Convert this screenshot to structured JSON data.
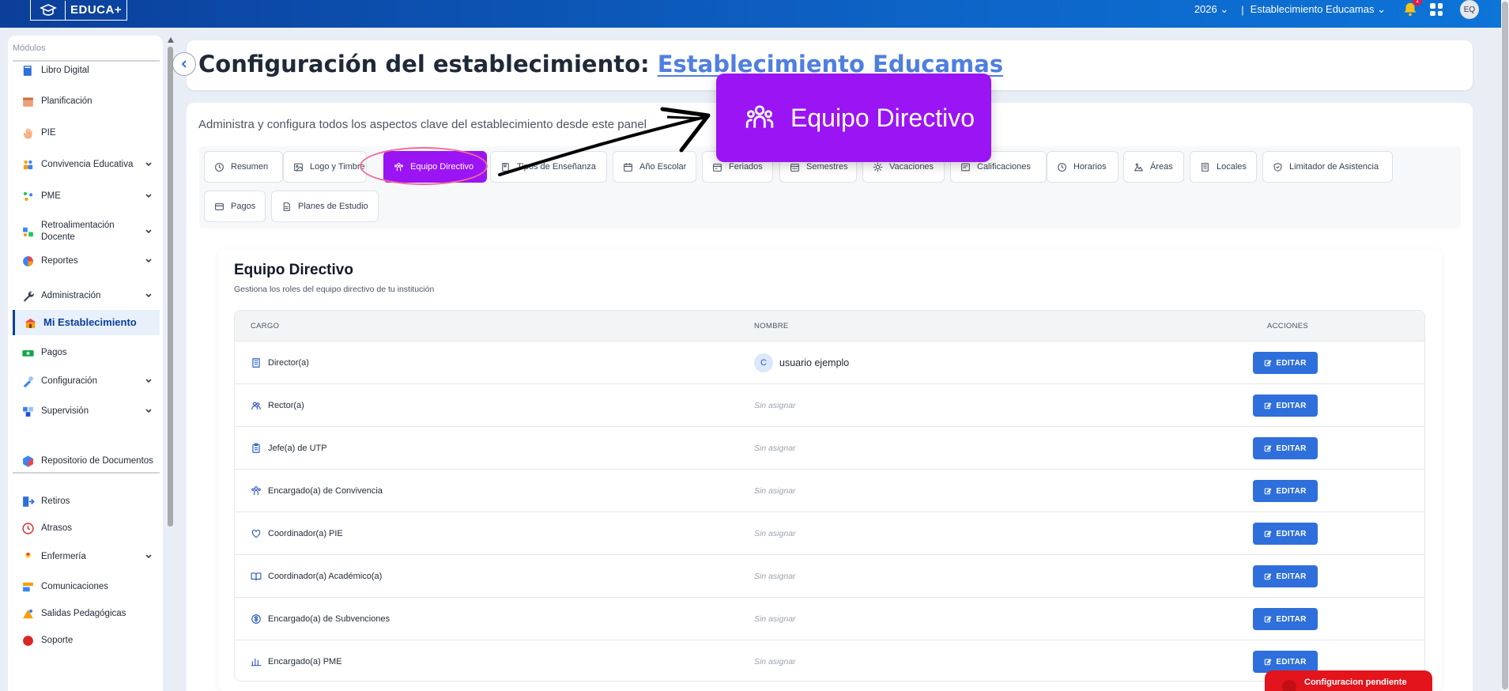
{
  "topbar": {
    "brand": "EDUCA+",
    "year": "2026",
    "separator": "|",
    "establishment": "Establecimiento Educamas",
    "notifications": "1",
    "user_initials": "EQ"
  },
  "sidebar": {
    "header": "Módulos",
    "items": [
      {
        "label": "Libro Digital",
        "icon": "book-icon"
      },
      {
        "label": "Planificación",
        "icon": "calendar-icon"
      },
      {
        "label": "PIE",
        "icon": "hand-icon"
      },
      {
        "label": "Convivencia Educativa",
        "icon": "people-icon",
        "chevron": true
      },
      {
        "label": "PME",
        "icon": "molecule-icon",
        "chevron": true
      },
      {
        "label": "Retroalimentación Docente",
        "icon": "feedback-icon",
        "chevron": true
      },
      {
        "label": "Reportes",
        "icon": "pie-chart-icon",
        "chevron": true
      },
      {
        "label": "Administración",
        "icon": "wrench-icon",
        "chevron": true
      },
      {
        "label": "Mi Establecimiento",
        "icon": "school-icon",
        "active": true
      },
      {
        "label": "Pagos",
        "icon": "money-icon"
      },
      {
        "label": "Configuración",
        "icon": "tools-icon",
        "chevron": true
      },
      {
        "label": "Supervisión",
        "icon": "supervision-icon",
        "chevron": true
      },
      {
        "label": "Repositorio de Documentos",
        "icon": "cube-icon"
      },
      {
        "label": "Retiros",
        "icon": "exit-icon"
      },
      {
        "label": "Atrasos",
        "icon": "clock-icon"
      },
      {
        "label": "Enfermería",
        "icon": "nurse-icon",
        "chevron": true
      },
      {
        "label": "Comunicaciones",
        "icon": "megaphone-icon"
      },
      {
        "label": "Salidas Pedagógicas",
        "icon": "trip-icon"
      },
      {
        "label": "Soporte",
        "icon": "support-icon"
      }
    ]
  },
  "page": {
    "title_prefix": "Configuración del establecimiento: ",
    "title_link": "Establecimiento Educamas",
    "subtitle": "Administra y configura todos los aspectos clave del establecimiento desde este panel"
  },
  "tabs": [
    {
      "label": "Resumen",
      "icon": "clock-circle-icon"
    },
    {
      "label": "Logo y Timbre",
      "icon": "image-icon"
    },
    {
      "label": "Equipo Directivo",
      "icon": "team-icon",
      "active": true
    },
    {
      "label": "Tipos de Enseñanza",
      "icon": "book-icon"
    },
    {
      "label": "Año Escolar",
      "icon": "calendar-icon"
    },
    {
      "label": "Feriados",
      "icon": "calendar-star-icon"
    },
    {
      "label": "Semestres",
      "icon": "calendar-range-icon"
    },
    {
      "label": "Vacaciones",
      "icon": "sun-icon"
    },
    {
      "label": "Calificaciones",
      "icon": "grades-icon"
    },
    {
      "label": "Horarios",
      "icon": "clock-icon"
    },
    {
      "label": "Áreas",
      "icon": "areas-icon"
    },
    {
      "label": "Locales",
      "icon": "building-icon"
    },
    {
      "label": "Limitador de Asistencia",
      "icon": "shield-icon"
    },
    {
      "label": "Pagos",
      "icon": "card-icon"
    },
    {
      "label": "Planes de Estudio",
      "icon": "document-icon"
    }
  ],
  "zoom_callout": {
    "label": "Equipo Directivo",
    "icon": "team-icon"
  },
  "section": {
    "title": "Equipo Directivo",
    "subtitle": "Gestiona los roles del equipo directivo de tu institución"
  },
  "table": {
    "headers": {
      "cargo": "CARGO",
      "nombre": "NOMBRE",
      "acciones": "ACCIONES"
    },
    "edit_label": "EDITAR",
    "rows": [
      {
        "cargo": "Director(a)",
        "nombre": "usuario ejemplo",
        "avatar": "C",
        "icon": "building-icon"
      },
      {
        "cargo": "Rector(a)",
        "nombre": "Sin asignar",
        "icon": "users-icon"
      },
      {
        "cargo": "Jefe(a) de UTP",
        "nombre": "Sin asignar",
        "icon": "clipboard-icon"
      },
      {
        "cargo": "Encargado(a) de Convivencia",
        "nombre": "Sin asignar",
        "icon": "team-icon"
      },
      {
        "cargo": "Coordinador(a) PIE",
        "nombre": "Sin asignar",
        "icon": "heart-icon"
      },
      {
        "cargo": "Coordinador(a) Académico(a)",
        "nombre": "Sin asignar",
        "icon": "open-book-icon"
      },
      {
        "cargo": "Encargado(a) de Subvenciones",
        "nombre": "Sin asignar",
        "icon": "dollar-icon"
      },
      {
        "cargo": "Encargado(a) PME",
        "nombre": "Sin asignar",
        "icon": "bar-chart-icon"
      }
    ]
  },
  "toast": {
    "label": "Configuracion pendiente"
  },
  "colors": {
    "brand_dark": "#0b3f9a",
    "active_tab": "#9b14f3",
    "edit_button": "#2e6fdb",
    "toast": "#e3141c"
  }
}
